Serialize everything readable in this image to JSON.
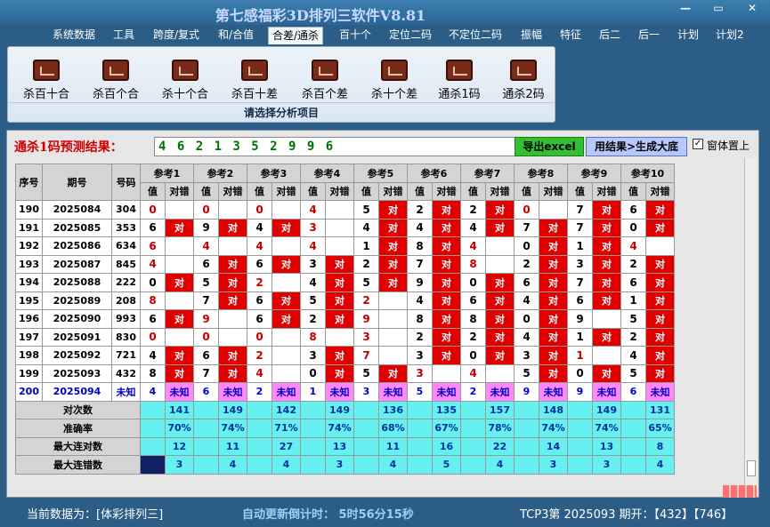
{
  "window": {
    "title": "第七感福彩3D排列三软件V8.81",
    "minimize": "—",
    "restore": "▭",
    "close": "✕"
  },
  "menu": [
    "系统数据",
    "工具",
    "跨度/复式",
    "和/合值",
    "合差/通杀",
    "百十个",
    "定位二码",
    "不定位二码",
    "振幅",
    "特征",
    "后二",
    "后一",
    "计划",
    "计划2"
  ],
  "menu_active": 4,
  "ribbon": {
    "buttons": [
      "杀百十合",
      "杀百个合",
      "杀十个合",
      "杀百十差",
      "杀百个差",
      "杀十个差",
      "通杀1码",
      "通杀2码"
    ],
    "caption": "请选择分析项目"
  },
  "prediction": {
    "label": "通杀1码预测结果：",
    "value": "4 6 2 1 3 5 2 9 9 6"
  },
  "buttons": {
    "excel": "导出excel",
    "generate": "用结果>生成大底"
  },
  "checkbox": {
    "label": "窗体置上",
    "checked": "✓"
  },
  "table": {
    "headers": {
      "seq": "序号",
      "issue": "期号",
      "number": "号码",
      "value": "值",
      "check": "对错"
    },
    "refs": [
      "参考1",
      "参考2",
      "参考3",
      "参考4",
      "参考5",
      "参考6",
      "参考7",
      "参考8",
      "参考9",
      "参考10"
    ],
    "rows": [
      {
        "seq": "190",
        "issue": "2025084",
        "num": "304",
        "vals": [
          "0",
          "0",
          "0",
          "4",
          "5",
          "2",
          "2",
          "0",
          "7",
          "6"
        ],
        "red": [
          1,
          1,
          1,
          1,
          0,
          0,
          0,
          1,
          0,
          0
        ],
        "checks": [
          0,
          0,
          0,
          0,
          1,
          1,
          1,
          0,
          1,
          1
        ]
      },
      {
        "seq": "191",
        "issue": "2025085",
        "num": "353",
        "vals": [
          "6",
          "9",
          "4",
          "3",
          "4",
          "4",
          "4",
          "7",
          "7",
          "0"
        ],
        "red": [
          0,
          0,
          0,
          1,
          0,
          0,
          0,
          0,
          0,
          0
        ],
        "checks": [
          1,
          1,
          1,
          0,
          1,
          1,
          1,
          1,
          1,
          1
        ]
      },
      {
        "seq": "192",
        "issue": "2025086",
        "num": "634",
        "vals": [
          "6",
          "4",
          "4",
          "4",
          "1",
          "8",
          "4",
          "0",
          "1",
          "4"
        ],
        "red": [
          1,
          1,
          1,
          1,
          0,
          0,
          1,
          0,
          0,
          1
        ],
        "checks": [
          0,
          0,
          0,
          0,
          1,
          1,
          0,
          1,
          1,
          0
        ]
      },
      {
        "seq": "193",
        "issue": "2025087",
        "num": "845",
        "vals": [
          "4",
          "6",
          "6",
          "3",
          "2",
          "7",
          "8",
          "2",
          "3",
          "2"
        ],
        "red": [
          1,
          0,
          0,
          0,
          0,
          0,
          1,
          0,
          0,
          0
        ],
        "checks": [
          0,
          1,
          1,
          1,
          1,
          1,
          0,
          1,
          1,
          1
        ]
      },
      {
        "seq": "194",
        "issue": "2025088",
        "num": "222",
        "vals": [
          "0",
          "5",
          "2",
          "4",
          "5",
          "9",
          "0",
          "6",
          "7",
          "6"
        ],
        "red": [
          0,
          0,
          1,
          0,
          0,
          0,
          0,
          0,
          0,
          0
        ],
        "checks": [
          1,
          1,
          0,
          1,
          1,
          1,
          1,
          1,
          1,
          1
        ]
      },
      {
        "seq": "195",
        "issue": "2025089",
        "num": "208",
        "vals": [
          "8",
          "7",
          "6",
          "5",
          "2",
          "4",
          "6",
          "4",
          "6",
          "1"
        ],
        "red": [
          1,
          0,
          0,
          0,
          1,
          0,
          0,
          0,
          0,
          0
        ],
        "checks": [
          0,
          1,
          1,
          1,
          0,
          1,
          1,
          1,
          1,
          1
        ]
      },
      {
        "seq": "196",
        "issue": "2025090",
        "num": "993",
        "vals": [
          "6",
          "9",
          "6",
          "2",
          "9",
          "8",
          "8",
          "0",
          "9",
          "5"
        ],
        "red": [
          0,
          1,
          0,
          0,
          1,
          0,
          0,
          0,
          0,
          0
        ],
        "checks": [
          1,
          0,
          1,
          1,
          0,
          1,
          1,
          1,
          0,
          1
        ]
      },
      {
        "seq": "197",
        "issue": "2025091",
        "num": "830",
        "vals": [
          "0",
          "0",
          "0",
          "8",
          "3",
          "2",
          "2",
          "4",
          "1",
          "2"
        ],
        "red": [
          1,
          1,
          1,
          1,
          1,
          0,
          0,
          0,
          0,
          0
        ],
        "checks": [
          0,
          0,
          0,
          0,
          0,
          1,
          1,
          1,
          1,
          1
        ]
      },
      {
        "seq": "198",
        "issue": "2025092",
        "num": "721",
        "vals": [
          "4",
          "6",
          "2",
          "3",
          "7",
          "3",
          "0",
          "3",
          "1",
          "4"
        ],
        "red": [
          0,
          0,
          1,
          0,
          1,
          0,
          0,
          0,
          1,
          0
        ],
        "checks": [
          1,
          1,
          0,
          1,
          0,
          1,
          1,
          1,
          0,
          1
        ]
      },
      {
        "seq": "199",
        "issue": "2025093",
        "num": "432",
        "vals": [
          "8",
          "7",
          "4",
          "0",
          "5",
          "3",
          "4",
          "5",
          "0",
          "5"
        ],
        "red": [
          0,
          0,
          1,
          0,
          0,
          1,
          1,
          0,
          0,
          0
        ],
        "checks": [
          1,
          1,
          0,
          1,
          1,
          0,
          0,
          1,
          1,
          1
        ]
      }
    ],
    "pred_row": {
      "seq": "200",
      "issue": "2025094",
      "num": "未知",
      "vals": [
        "4",
        "6",
        "2",
        "1",
        "3",
        "5",
        "2",
        "9",
        "9",
        "6"
      ],
      "unknown": "未知"
    },
    "stats": [
      {
        "label": "对次数",
        "values": [
          "141",
          "149",
          "142",
          "149",
          "136",
          "135",
          "157",
          "148",
          "149",
          "131"
        ]
      },
      {
        "label": "准确率",
        "values": [
          "70%",
          "74%",
          "71%",
          "74%",
          "68%",
          "67%",
          "78%",
          "74%",
          "74%",
          "65%"
        ]
      },
      {
        "label": "最大连对数",
        "values": [
          "12",
          "11",
          "27",
          "13",
          "11",
          "16",
          "22",
          "14",
          "13",
          "8"
        ]
      },
      {
        "label": "最大连错数",
        "values": [
          "3",
          "4",
          "4",
          "3",
          "4",
          "5",
          "4",
          "3",
          "3",
          "4"
        ]
      }
    ],
    "check_text": "对"
  },
  "status": {
    "current_data": "当前数据为：[体彩排列三]",
    "countdown": "自动更新倒计时：  5时56分15秒",
    "latest": "TCP3第 2025093 期开：【432】【746】"
  },
  "colors": {
    "accent": "#2b5d86",
    "check_red": "#e00000",
    "stat_cyan": "#66f0f0",
    "unknown_pink": "#ff88ff"
  }
}
